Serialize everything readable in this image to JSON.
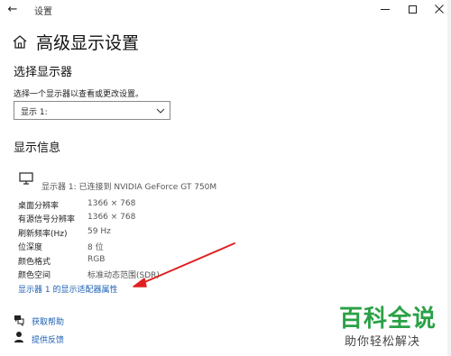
{
  "window": {
    "title": "设置",
    "back_icon": "back-arrow-icon",
    "controls": [
      "minimize-icon",
      "maximize-icon",
      "close-icon"
    ]
  },
  "header": {
    "icon": "home-icon",
    "title": "高级显示设置"
  },
  "select_display": {
    "heading": "选择显示器",
    "description": "选择一个显示器以查看或更改设置。",
    "selected": "显示 1:"
  },
  "display_info": {
    "heading": "显示信息",
    "monitor_status": "显示器 1: 已连接到 NVIDIA GeForce GT 750M",
    "rows": [
      {
        "label": "桌面分辨率",
        "value": "1366 × 768"
      },
      {
        "label": "有源信号分辨率",
        "value": "1366 × 768"
      },
      {
        "label": "刷新频率(Hz)",
        "value": "59 Hz"
      },
      {
        "label": "位深度",
        "value": "8 位"
      },
      {
        "label": "颜色格式",
        "value": "RGB"
      },
      {
        "label": "颜色空间",
        "value": "标准动态范围(SDR)"
      }
    ],
    "adapter_link": "显示器 1 的显示适配器属性"
  },
  "help": {
    "get_help": "获取帮助",
    "feedback": "提供反馈"
  },
  "watermark": {
    "main": "百科全说",
    "sub": "助你轻松解决"
  },
  "colors": {
    "link": "#1a5fb4",
    "arrow": "#e02020",
    "watermark": "#2aa146"
  }
}
